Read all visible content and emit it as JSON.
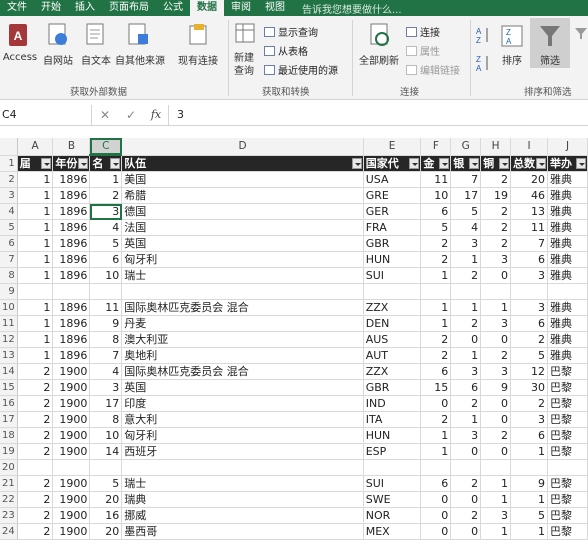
{
  "tabs": [
    "文件",
    "开始",
    "插入",
    "页面布局",
    "公式",
    "数据",
    "审阅",
    "视图"
  ],
  "active_tab": "数据",
  "tell_me": "告诉我您想要做什么...",
  "ribbon": {
    "get_external": {
      "buttons": [
        "Access",
        "自网站",
        "自文本",
        "自其他来源",
        "现有连接"
      ],
      "label": "获取外部数据"
    },
    "get_transform": {
      "new_query": "新建\n查询",
      "items": [
        "显示查询",
        "从表格",
        "最近使用的源"
      ],
      "label": "获取和转换"
    },
    "connections": {
      "refresh_all": "全部刷新",
      "items": [
        "连接",
        "属性",
        "编辑链接"
      ],
      "label": "连接"
    },
    "sort_filter": {
      "sort": "排序",
      "filter": "筛选",
      "label": "排序和筛选"
    }
  },
  "formula_bar": {
    "name_box": "C4",
    "value": "3"
  },
  "columns": [
    "A",
    "B",
    "C",
    "D",
    "E",
    "F",
    "G",
    "H",
    "I",
    "J"
  ],
  "selected_column": "C",
  "headers": [
    "届",
    "年份",
    "名",
    "队伍",
    "国家代",
    "金",
    "银",
    "铜",
    "总数",
    "举办"
  ],
  "rows": [
    {
      "r": "2",
      "c": [
        "1",
        "1896",
        "1",
        "美国",
        "USA",
        "11",
        "7",
        "2",
        "20",
        "雅典"
      ]
    },
    {
      "r": "3",
      "c": [
        "1",
        "1896",
        "2",
        "希腊",
        "GRE",
        "10",
        "17",
        "19",
        "46",
        "雅典"
      ]
    },
    {
      "r": "4",
      "c": [
        "1",
        "1896",
        "3",
        "德国",
        "GER",
        "6",
        "5",
        "2",
        "13",
        "雅典"
      ]
    },
    {
      "r": "5",
      "c": [
        "1",
        "1896",
        "4",
        "法国",
        "FRA",
        "5",
        "4",
        "2",
        "11",
        "雅典"
      ]
    },
    {
      "r": "6",
      "c": [
        "1",
        "1896",
        "5",
        "英国",
        "GBR",
        "2",
        "3",
        "2",
        "7",
        "雅典"
      ]
    },
    {
      "r": "7",
      "c": [
        "1",
        "1896",
        "6",
        "匈牙利",
        "HUN",
        "2",
        "1",
        "3",
        "6",
        "雅典"
      ]
    },
    {
      "r": "8",
      "c": [
        "1",
        "1896",
        "10",
        "瑞士",
        "SUI",
        "1",
        "2",
        "0",
        "3",
        "雅典"
      ]
    },
    {
      "r": "9",
      "c": [
        "",
        "",
        "",
        "",
        "",
        "",
        "",
        "",
        "",
        ""
      ]
    },
    {
      "r": "10",
      "c": [
        "1",
        "1896",
        "11",
        "国际奥林匹克委员会 混合",
        "ZZX",
        "1",
        "1",
        "1",
        "3",
        "雅典"
      ]
    },
    {
      "r": "11",
      "c": [
        "1",
        "1896",
        "9",
        "丹麦",
        "DEN",
        "1",
        "2",
        "3",
        "6",
        "雅典"
      ]
    },
    {
      "r": "12",
      "c": [
        "1",
        "1896",
        "8",
        "澳大利亚",
        "AUS",
        "2",
        "0",
        "0",
        "2",
        "雅典"
      ]
    },
    {
      "r": "13",
      "c": [
        "1",
        "1896",
        "7",
        "奥地利",
        "AUT",
        "2",
        "1",
        "2",
        "5",
        "雅典"
      ]
    },
    {
      "r": "14",
      "c": [
        "2",
        "1900",
        "4",
        "国际奥林匹克委员会 混合",
        "ZZX",
        "6",
        "3",
        "3",
        "12",
        "巴黎"
      ]
    },
    {
      "r": "15",
      "c": [
        "2",
        "1900",
        "3",
        "英国",
        "GBR",
        "15",
        "6",
        "9",
        "30",
        "巴黎"
      ]
    },
    {
      "r": "16",
      "c": [
        "2",
        "1900",
        "17",
        "印度",
        "IND",
        "0",
        "2",
        "0",
        "2",
        "巴黎"
      ]
    },
    {
      "r": "17",
      "c": [
        "2",
        "1900",
        "8",
        "意大利",
        "ITA",
        "2",
        "1",
        "0",
        "3",
        "巴黎"
      ]
    },
    {
      "r": "18",
      "c": [
        "2",
        "1900",
        "10",
        "匈牙利",
        "HUN",
        "1",
        "3",
        "2",
        "6",
        "巴黎"
      ]
    },
    {
      "r": "19",
      "c": [
        "2",
        "1900",
        "14",
        "西班牙",
        "ESP",
        "1",
        "0",
        "0",
        "1",
        "巴黎"
      ]
    },
    {
      "r": "20",
      "c": [
        "",
        "",
        "",
        "",
        "",
        "",
        "",
        "",
        "",
        ""
      ]
    },
    {
      "r": "21",
      "c": [
        "2",
        "1900",
        "5",
        "瑞士",
        "SUI",
        "6",
        "2",
        "1",
        "9",
        "巴黎"
      ]
    },
    {
      "r": "22",
      "c": [
        "2",
        "1900",
        "20",
        "瑞典",
        "SWE",
        "0",
        "0",
        "1",
        "1",
        "巴黎"
      ]
    },
    {
      "r": "23",
      "c": [
        "2",
        "1900",
        "16",
        "挪威",
        "NOR",
        "0",
        "2",
        "3",
        "5",
        "巴黎"
      ]
    },
    {
      "r": "24",
      "c": [
        "2",
        "1900",
        "20",
        "墨西哥",
        "MEX",
        "0",
        "0",
        "1",
        "1",
        "巴黎"
      ]
    }
  ]
}
